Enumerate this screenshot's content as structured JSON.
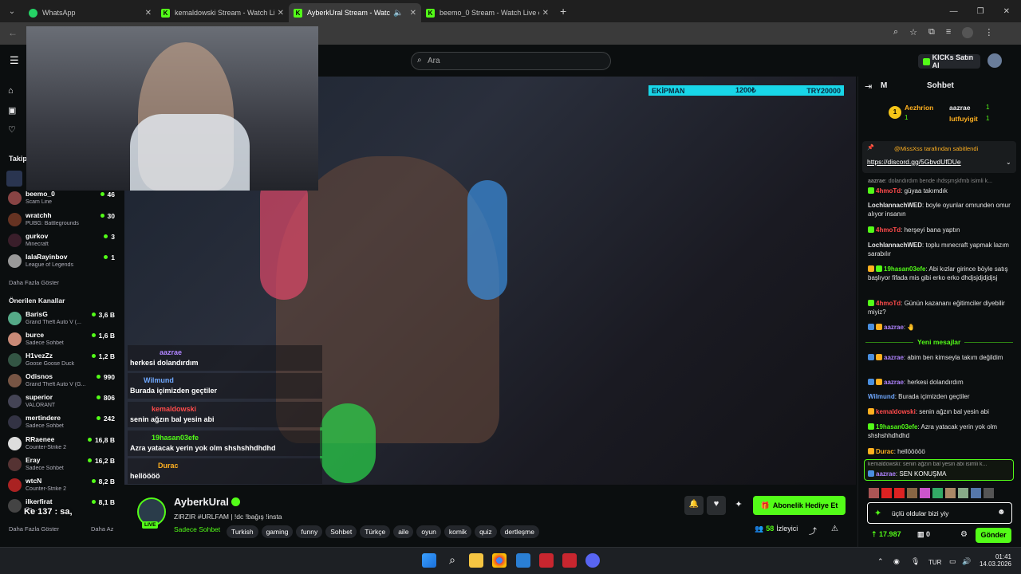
{
  "browser": {
    "tabs": [
      {
        "title": "WhatsApp",
        "color": "#25d366",
        "active": false
      },
      {
        "title": "kemaldowski Stream - Watch Li",
        "color": "#53fc18",
        "active": false
      },
      {
        "title": "AyberkUral Stream - Watch",
        "color": "#53fc18",
        "active": true
      },
      {
        "title": "beemo_0 Stream - Watch Live c",
        "color": "#53fc18",
        "active": false
      }
    ],
    "new_tab_label": "+"
  },
  "kick": {
    "search_placeholder": "Ara",
    "buy_kicks_label": "KICKs Satın Al",
    "following_label": "Takip",
    "followed_channels": [
      {
        "name": "beemo_0",
        "category": "Scam Line",
        "viewers": "46"
      },
      {
        "name": "wratchh",
        "category": "PUBG: Battlegrounds",
        "viewers": "30"
      },
      {
        "name": "gurkov",
        "category": "Minecraft",
        "viewers": "3"
      },
      {
        "name": "lalaRayinbov",
        "category": "League of Legends",
        "viewers": "1"
      }
    ],
    "show_more_label": "Daha Fazla Göster",
    "recommended_label": "Önerilen Kanallar",
    "recommended_channels": [
      {
        "name": "BarisG",
        "category": "Grand Theft Auto V (...",
        "viewers": "3,6 B"
      },
      {
        "name": "burce",
        "category": "Sadece Sohbet",
        "viewers": "1,6 B"
      },
      {
        "name": "H1vezZz",
        "category": "Goose Goose Duck",
        "viewers": "1,2 B"
      },
      {
        "name": "Odisnos",
        "category": "Grand Theft Auto V (G...",
        "viewers": "990"
      },
      {
        "name": "superior",
        "category": "VALORANT",
        "viewers": "806"
      },
      {
        "name": "mertindere",
        "category": "Sadece Sohbet",
        "viewers": "242"
      },
      {
        "name": "RRaenee",
        "category": "Counter-Strike 2",
        "viewers": "16,8 B"
      },
      {
        "name": "Eray",
        "category": "Sadece Sohbet",
        "viewers": "16,2 B"
      },
      {
        "name": "wtcN",
        "category": "Counter-Strike 2",
        "viewers": "8,2 B"
      },
      {
        "name": "ilkerfirat",
        "category": "Sa...",
        "viewers": "8,1 B"
      }
    ],
    "show_more_label_2": "Daha Fazla Göster",
    "show_less_label": "Daha Az"
  },
  "stream": {
    "donation_bar": {
      "left": "EKİPMAN",
      "mid": "1200₺",
      "right": "TRY20000"
    },
    "overlay_chat": [
      {
        "user": "aazrae",
        "text": "herkesi dolandırdım",
        "color": "#b084ff"
      },
      {
        "user": "Wilmund",
        "text": "Burada içimizden geçtiler",
        "color": "#6fa8ff"
      },
      {
        "user": "kemaldowski",
        "text": "senin ağzın bal yesin abi",
        "color": "#ff4b4b"
      },
      {
        "user": "19hasan03efe",
        "text": "Azra yatacak yerin yok olm shshshhdhdhd",
        "color": "#53fc18"
      },
      {
        "user": "Durac",
        "text": "hellöööö",
        "color": "#ffb020"
      }
    ],
    "subtitle": "Ke 137 : sa,",
    "streamer_name": "AyberkUral",
    "live_label": "LIVE",
    "stream_title": "ZIRZIR #URLFAM  | !dc !bağış !insta",
    "category": "Sadece Sohbet",
    "tags": [
      "Turkish",
      "gaming",
      "funny",
      "Sohbet",
      "Türkçe",
      "aile",
      "oyun",
      "komik",
      "quiz",
      "dertleşme"
    ],
    "gift_sub_label": "Abonelik Hediye Et",
    "viewers": "58",
    "viewers_label": "İzleyici"
  },
  "chat": {
    "title": "Sohbet",
    "top_gifters": [
      {
        "name": "Aezhrion",
        "count": "1"
      },
      {
        "name": "aazrae",
        "count": "1"
      },
      {
        "name": "lutfuyigit",
        "count": "1"
      }
    ],
    "pinned_by": "@MissXss tarafından sabitlendi",
    "pinned_link": "https://discord.gg/5GbvdUfDUe",
    "messages": [
      {
        "user": "aazrae",
        "text": "dolandırdım bende ıhdsşmşkfmb isimli k...",
        "color": "#888"
      },
      {
        "user": "4hmoTd",
        "text": "güyaa takımdık",
        "color": "#ff4b4b"
      },
      {
        "user": "LochlannachWED",
        "text": "boyle oyunlar omrunden omur alıyor insanın",
        "color": "#e6e6e6"
      },
      {
        "user": "4hmoTd",
        "text": "herşeyi bana yaptın",
        "color": "#ff4b4b"
      },
      {
        "user": "LochlannachWED",
        "text": "toplu mınecraft yapmak lazım sarabılır",
        "color": "#e6e6e6"
      },
      {
        "user": "19hasan03efe",
        "text": "Abi kızlar girince böyle satış başlıyor fifada mis gibi erko erko dhdjsjdjdjdjsj",
        "color": "#53fc18"
      },
      {
        "user": "4hmoTd",
        "text": "Günün kazananı eğitimciler diyebilir miyiz?",
        "color": "#ff4b4b"
      },
      {
        "user": "aazrae",
        "text": "",
        "color": "#b084ff"
      }
    ],
    "new_messages_label": "Yeni mesajlar",
    "new_messages": [
      {
        "user": "aazrae",
        "text": "abim ben kimseyla takım değildim",
        "color": "#b084ff"
      },
      {
        "user": "aazrae",
        "text": "herkesi dolandırdım",
        "color": "#b084ff"
      },
      {
        "user": "Wilmund",
        "text": "Burada içimizden geçtiler",
        "color": "#6fa8ff"
      },
      {
        "user": "kemaldowski",
        "text": "senin ağzın bal yesin abi",
        "color": "#ff4b4b"
      },
      {
        "user": "19hasan03efe",
        "text": "Azra yatacak yerin yok olm shshshhdhdhd",
        "color": "#53fc18"
      },
      {
        "user": "Durac",
        "text": "hellööööö",
        "color": "#ffb020"
      }
    ],
    "reply_to": "kemaldowski: senin ağzın bal yesin abi isimli k...",
    "reply_user": "aazrae",
    "reply_text": "SEN KONUŞMA",
    "input_value": "üçlü oldular bizi yiy",
    "kicks_balance": "17.987",
    "points": "0",
    "send_label": "Gönder"
  },
  "taskbar": {
    "lang": "TUR",
    "time": "01:41",
    "date": "14.03.2026"
  }
}
